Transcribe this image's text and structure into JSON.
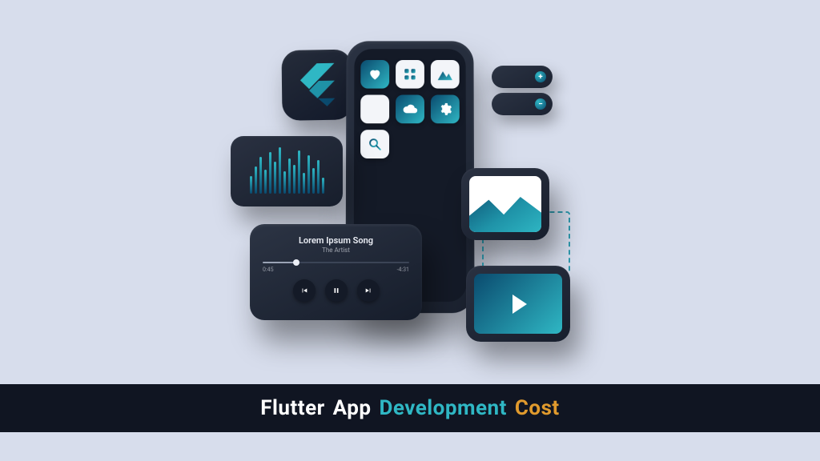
{
  "bars_heights": [
    22,
    34,
    46,
    30,
    52,
    40,
    58,
    28,
    44,
    36,
    54,
    26,
    48,
    32,
    42,
    20
  ],
  "music": {
    "title": "Lorem Ipsum Song",
    "artist": "The Artist",
    "time_elapsed": "0:45",
    "time_remaining": "-4:31"
  },
  "pills": {
    "plus": "+",
    "minus": "−"
  },
  "title": {
    "w1": "Flutter",
    "w2": "App",
    "w3": "Development",
    "w4": "Cost"
  },
  "icons": {
    "heart": "heart",
    "grid": "grid",
    "mountain": "mountain",
    "blank": "",
    "cloud": "cloud",
    "gear": "gear",
    "search": "search"
  }
}
